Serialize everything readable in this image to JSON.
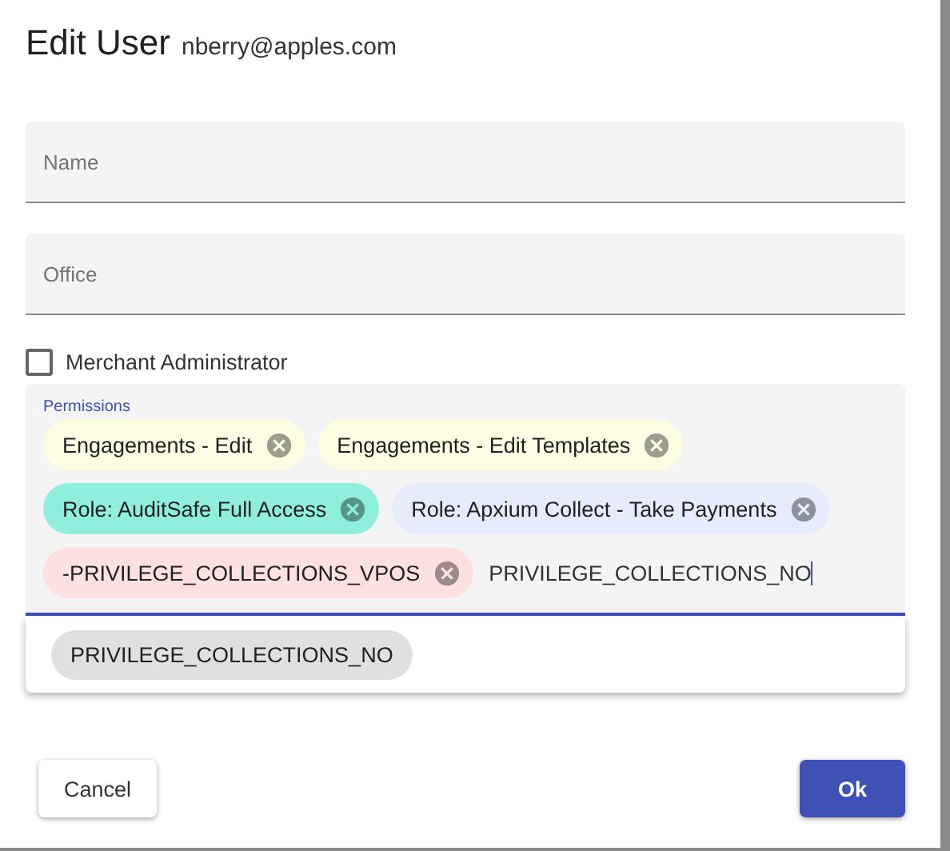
{
  "dialog": {
    "title": "Edit User",
    "subtitle": "nberry@apples.com"
  },
  "fields": [
    {
      "placeholder": "Name"
    },
    {
      "placeholder": "Office"
    }
  ],
  "checkbox": {
    "label": "Merchant Administrator",
    "checked": false
  },
  "permissions": {
    "label": "Permissions",
    "chips": [
      {
        "label": "Engagements - Edit",
        "color": "#fdfde4"
      },
      {
        "label": "Engagements - Edit Templates",
        "color": "#fdfde4"
      },
      {
        "label": "Role: AuditSafe Full Access",
        "color": "#8fefdc"
      },
      {
        "label": "Role: Apxium Collect - Take Payments",
        "color": "#e6ecfc"
      },
      {
        "label": "-PRIVILEGE_COLLECTIONS_VPOS",
        "color": "#fde0e0"
      }
    ],
    "value": "PRIVILEGE_COLLECTIONS_NO"
  },
  "suggestions": [
    "PRIVILEGE_COLLECTIONS_NO"
  ],
  "buttons": [
    {
      "label": "Cancel",
      "kind": "secondary"
    },
    {
      "label": "Ok",
      "kind": "primary"
    }
  ]
}
